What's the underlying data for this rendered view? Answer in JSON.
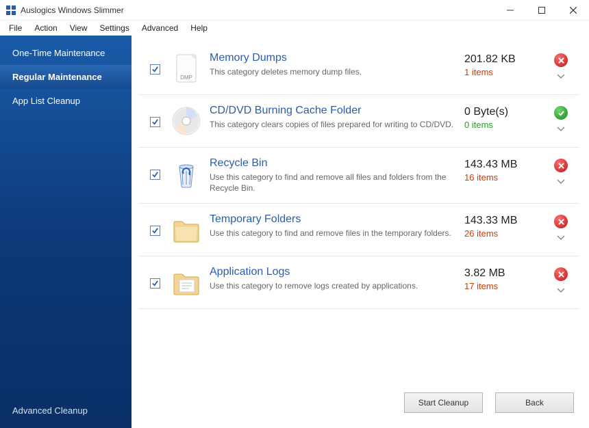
{
  "titlebar": {
    "title": "Auslogics Windows Slimmer"
  },
  "menu": {
    "file": "File",
    "action": "Action",
    "view": "View",
    "settings": "Settings",
    "advanced": "Advanced",
    "help": "Help"
  },
  "sidebar": {
    "items": [
      "One-Time Maintenance",
      "Regular Maintenance",
      "App List Cleanup"
    ],
    "footer": "Advanced Cleanup"
  },
  "categories": [
    {
      "title": "Memory Dumps",
      "desc": "This category deletes memory dump files.",
      "size": "201.82 KB",
      "count": "1",
      "unit": "items",
      "status": "red",
      "icon": "dmp"
    },
    {
      "title": "CD/DVD Burning Cache Folder",
      "desc": "This category clears copies of files prepared for writing to CD/DVD.",
      "size": "0 Byte(s)",
      "count": "0",
      "unit": "items",
      "status": "green",
      "icon": "disc"
    },
    {
      "title": "Recycle Bin",
      "desc": "Use this category to find and remove all files and folders from the Recycle Bin.",
      "size": "143.43 MB",
      "count": "16",
      "unit": "items",
      "status": "red",
      "icon": "bin"
    },
    {
      "title": "Temporary Folders",
      "desc": "Use this category to find and remove files in the temporary folders.",
      "size": "143.33 MB",
      "count": "26",
      "unit": "items",
      "status": "red",
      "icon": "folder"
    },
    {
      "title": "Application Logs",
      "desc": "Use this category to remove logs created by applications.",
      "size": "3.82 MB",
      "count": "17",
      "unit": "items",
      "status": "red",
      "icon": "logs"
    }
  ],
  "buttons": {
    "start": "Start Cleanup",
    "back": "Back"
  }
}
